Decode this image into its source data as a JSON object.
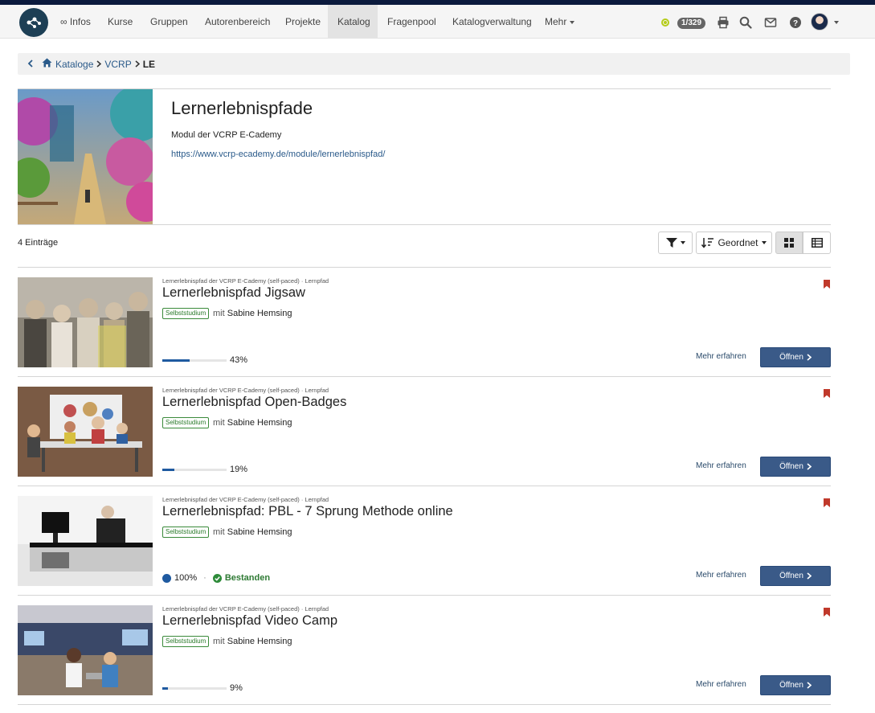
{
  "nav": {
    "items": [
      "∞ Infos",
      "Kurse",
      "Gruppen",
      "Autorenbereich",
      "Projekte",
      "Katalog",
      "Fragenpool",
      "Katalogverwaltung",
      "Mehr"
    ],
    "active": "Katalog",
    "badge": "1/329",
    "accent": "#1d3f55"
  },
  "breadcrumb": {
    "items": [
      "Kataloge",
      "VCRP"
    ],
    "current": "LE"
  },
  "header": {
    "title": "Lernerlebnispfade",
    "subtitle": "Modul der VCRP E-Cademy",
    "link": "https://www.vcrp-ecademy.de/module/lernerlebnispfad/"
  },
  "toolbar": {
    "count": "4 Einträge",
    "sort_label": "Geordnet"
  },
  "entries": [
    {
      "meta": "Lernerlebnispfad der VCRP E-Cademy (self-paced) · Lernpfad",
      "title": "Lernerlebnispfad Jigsaw",
      "tag": "Selbststudium",
      "mit": "mit",
      "owner": "Sabine Hemsing",
      "progress": 43,
      "progress_label": "43%",
      "mehr": "Mehr erfahren",
      "open": "Öffnen"
    },
    {
      "meta": "Lernerlebnispfad der VCRP E-Cademy (self-paced) · Lernpfad",
      "title": "Lernerlebnispfad Open-Badges",
      "tag": "Selbststudium",
      "mit": "mit",
      "owner": "Sabine Hemsing",
      "progress": 19,
      "progress_label": "19%",
      "mehr": "Mehr erfahren",
      "open": "Öffnen"
    },
    {
      "meta": "Lernerlebnispfad der VCRP E-Cademy (self-paced) · Lernpfad",
      "title": "Lernerlebnispfad: PBL - 7 Sprung Methode online",
      "tag": "Selbststudium",
      "mit": "mit",
      "owner": "Sabine Hemsing",
      "progress": 100,
      "progress_label": "100%",
      "passed": "Bestanden",
      "mehr": "Mehr erfahren",
      "open": "Öffnen"
    },
    {
      "meta": "Lernerlebnispfad der VCRP E-Cademy (self-paced) · Lernpfad",
      "title": "Lernerlebnispfad Video Camp",
      "tag": "Selbststudium",
      "mit": "mit",
      "owner": "Sabine Hemsing",
      "progress": 9,
      "progress_label": "9%",
      "mehr": "Mehr erfahren",
      "open": "Öffnen"
    }
  ]
}
